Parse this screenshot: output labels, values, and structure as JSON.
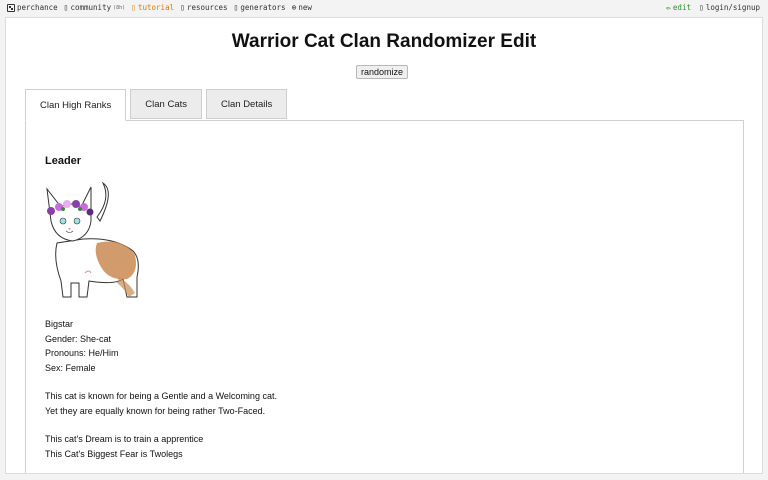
{
  "nav": {
    "left": [
      {
        "label": "perchance",
        "icon": "dice-icon"
      },
      {
        "label": "community",
        "icon": "chat-icon",
        "count": "(8h)"
      },
      {
        "label": "tutorial",
        "icon": "book-icon"
      },
      {
        "label": "resources",
        "icon": "folder-icon"
      },
      {
        "label": "generators",
        "icon": "gear-icon"
      },
      {
        "label": "new",
        "icon": "plus-circle-icon"
      }
    ],
    "right": [
      {
        "label": "edit",
        "icon": "pencil-icon"
      },
      {
        "label": "login/signup",
        "icon": "user-icon"
      }
    ]
  },
  "page": {
    "title": "Warrior Cat Clan Randomizer Edit",
    "randomize_label": "randomize"
  },
  "tabs": [
    {
      "label": "Clan High Ranks",
      "active": true
    },
    {
      "label": "Clan Cats",
      "active": false
    },
    {
      "label": "Clan Details",
      "active": false
    }
  ],
  "leader": {
    "heading": "Leader",
    "name": "Bigstar",
    "gender": "Gender: She-cat",
    "pronouns": "Pronouns: He/Him",
    "sex": "Sex: Female",
    "known_for": "This cat is known for being a Gentle and a Welcoming cat.",
    "also_known": "Yet they are equally known for being rather Two-Faced.",
    "dream": "This cat's Dream is to train a apprentice",
    "fear": "This Cat's Biggest Fear is Twolegs"
  },
  "colors": {
    "tutorial": "#e07a00",
    "edit": "#2f8f2f",
    "fur_patch": "#c98a52",
    "flower_crown": "#8a3fa8"
  }
}
